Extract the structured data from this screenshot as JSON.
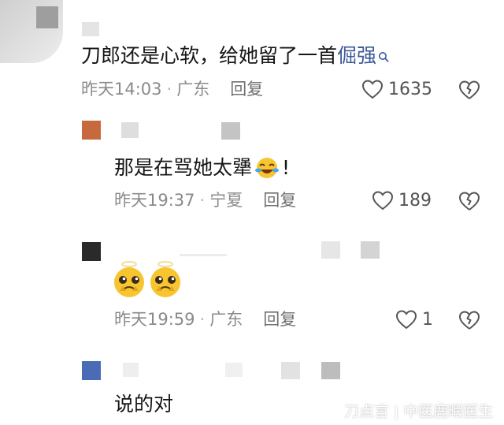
{
  "colors": {
    "text": "#161616",
    "meta": "#8a8a8a",
    "link": "#3d5a99",
    "emoji_yellow": "#f6c52f"
  },
  "comments": [
    {
      "text_before_link": "刀郎还是心软，给她留了一首",
      "link_text": "倔强",
      "time": "昨天14:03",
      "location": "广东",
      "reply_label": "回复",
      "likes": "1635"
    },
    {
      "text": "那是在骂她太犟",
      "text_suffix": "!",
      "time": "昨天19:37",
      "location": "宁夏",
      "reply_label": "回复",
      "likes": "189"
    },
    {
      "time": "昨天19:59",
      "location": "广东",
      "reply_label": "回复",
      "likes": "1"
    },
    {
      "text": "说的对"
    }
  ],
  "watermark": {
    "text": "刀点言",
    "separator": "|",
    "account": "中医鹿暇医生"
  },
  "icons": {
    "like": "heart-outline-icon",
    "dislike": "broken-heart-icon",
    "search": "search-icon",
    "emoji_laugh": "laughing-crying-emoji-icon",
    "emoji_plead": "pleading-emoji-icon"
  }
}
